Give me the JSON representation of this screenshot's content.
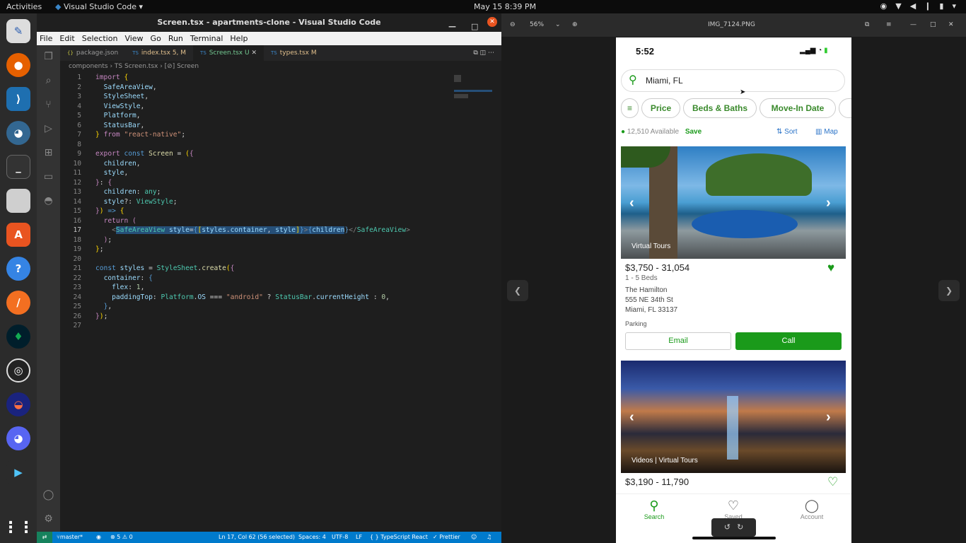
{
  "topbar": {
    "activities": "Activities",
    "app": "Visual Studio Code",
    "clock": "May 15  8:39 PM"
  },
  "vscode": {
    "title": "Screen.tsx - apartments-clone - Visual Studio Code",
    "menu": [
      "File",
      "Edit",
      "Selection",
      "View",
      "Go",
      "Run",
      "Terminal",
      "Help"
    ],
    "tabs": [
      {
        "type": "{}",
        "name": "package.json",
        "badge": ""
      },
      {
        "type": "TS",
        "name": "index.tsx",
        "badge": "5, M"
      },
      {
        "type": "TS",
        "name": "Screen.tsx",
        "badge": "U"
      },
      {
        "type": "TS",
        "name": "types.tsx",
        "badge": "M"
      }
    ],
    "breadcrumb": "components  ›  TS Screen.tsx  ›  [⊘] Screen",
    "line_numbers": [
      "1",
      "2",
      "3",
      "4",
      "5",
      "6",
      "7",
      "8",
      "9",
      "10",
      "11",
      "12",
      "13",
      "14",
      "15",
      "16",
      "17",
      "18",
      "19",
      "20",
      "21",
      "22",
      "23",
      "24",
      "25",
      "26",
      "27"
    ],
    "status": {
      "branch": "master*",
      "problems": "⊗ 5 ⚠ 0",
      "position": "Ln 17, Col 62 (56 selected)",
      "spaces": "Spaces: 4",
      "encoding": "UTF-8",
      "eol": "LF",
      "language": "{ } TypeScript React",
      "prettier": "✓ Prettier"
    }
  },
  "viewer": {
    "zoom": "56%",
    "filename": "IMG_7124.PNG"
  },
  "phone": {
    "time": "5:52",
    "search": "Miami, FL",
    "filters": [
      "Price",
      "Beds & Baths",
      "Move-In Date"
    ],
    "available": "12,510 Available",
    "save": "Save",
    "sort": "Sort",
    "map": "Map",
    "card1": {
      "tag": "Virtual Tours",
      "price": "$3,750 - 31,054",
      "beds": "1 - 5 Beds",
      "name": "The Hamilton",
      "address1": "555 NE 34th St",
      "address2": "Miami, FL 33137",
      "amenity": "Parking",
      "email": "Email",
      "call": "Call"
    },
    "card2": {
      "tag": "Videos | Virtual Tours",
      "price": "$3,190 - 11,790"
    },
    "nav": [
      "Search",
      "Saved",
      "Account"
    ]
  },
  "colors": {
    "accent_green": "#1a9a1a",
    "vscode_blue": "#007acc"
  }
}
